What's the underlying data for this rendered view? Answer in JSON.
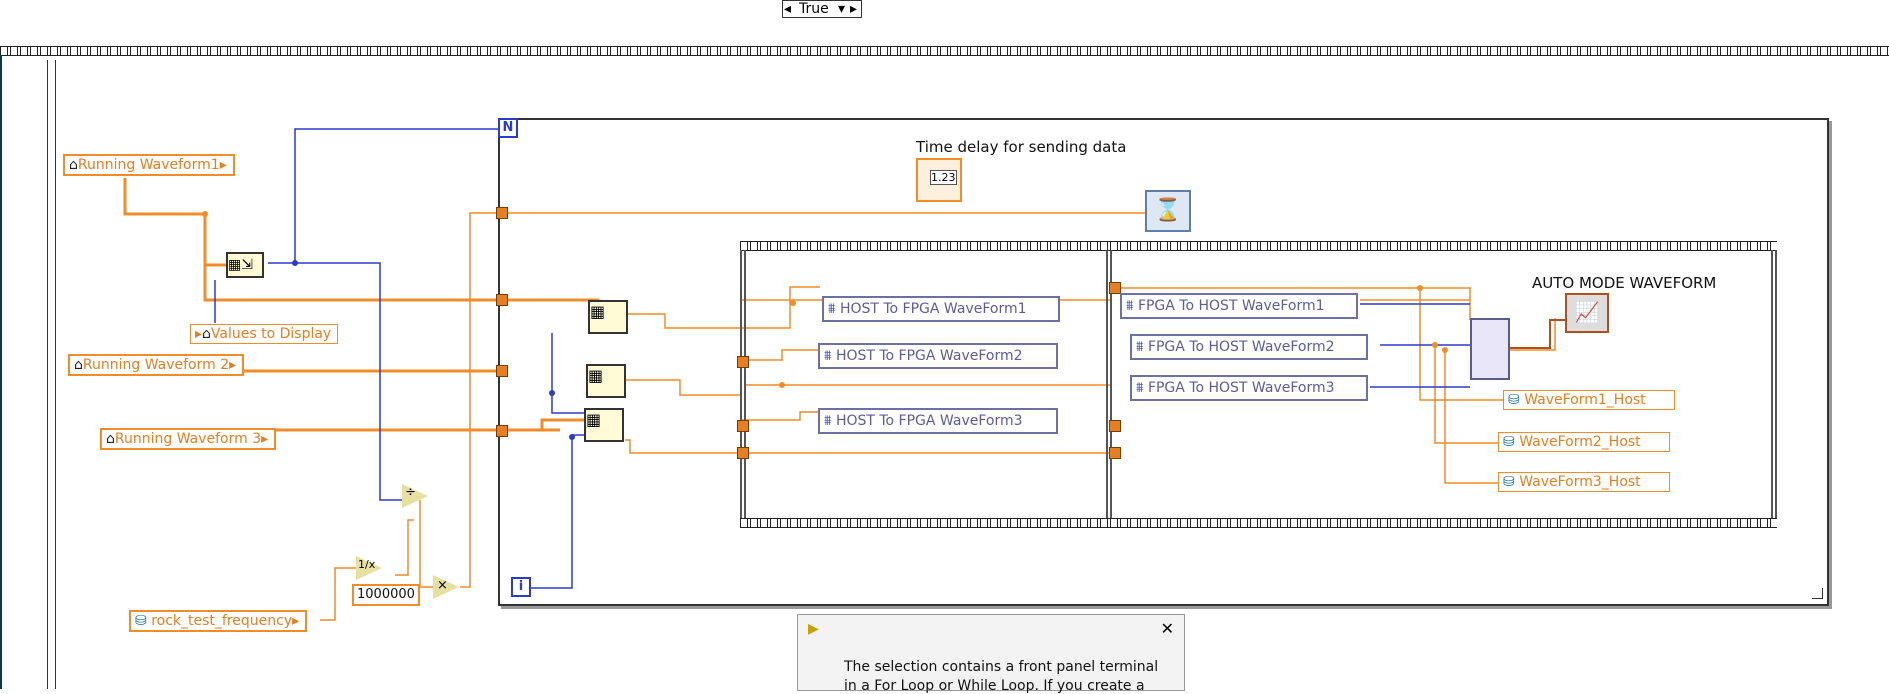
{
  "case_selector": {
    "value": "True"
  },
  "controls": {
    "running_waveform1": "Running Waveform1",
    "values_to_display": "Values to Display",
    "running_waveform2": "Running Waveform 2",
    "running_waveform3": "Running Waveform 3",
    "rock_test_frequency": "rock_test_frequency",
    "constant_1000000": "1000000"
  },
  "loop": {
    "count_label": "N",
    "iteration_label": "i"
  },
  "delay": {
    "label": "Time delay for sending data",
    "value_icon": "1.23"
  },
  "host_to_fpga": [
    "HOST To FPGA WaveForm1",
    "HOST To FPGA WaveForm2",
    "HOST To FPGA WaveForm3"
  ],
  "fpga_to_host": [
    "FPGA To HOST WaveForm1",
    "FPGA To HOST WaveForm2",
    "FPGA To HOST WaveForm3"
  ],
  "host_outputs": [
    "WaveForm1_Host",
    "WaveForm2_Host",
    "WaveForm3_Host"
  ],
  "graph": {
    "label": "AUTO MODE WAVEFORM"
  },
  "dialog": {
    "message_line1": "The selection contains a front panel terminal",
    "message_line2": "in a For Loop or While Loop. If you create a",
    "close_symbol": "✕"
  },
  "colors": {
    "wire_orange": "#f28c28",
    "wire_blue": "#2a3cc9",
    "fpga_purple": "#6f6fa8"
  }
}
